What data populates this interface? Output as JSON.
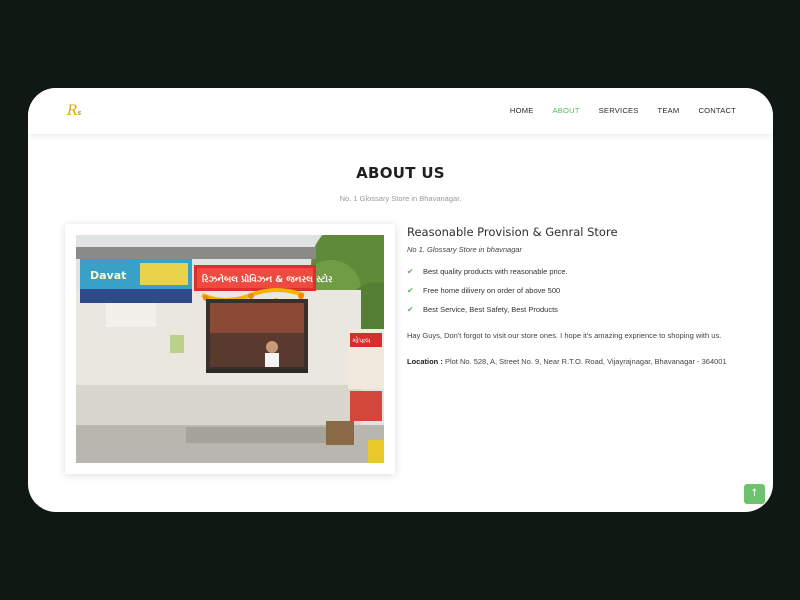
{
  "logo": {
    "text": "R",
    "sub": "s"
  },
  "nav": {
    "items": [
      "HOME",
      "ABOUT",
      "SERVICES",
      "TEAM",
      "CONTACT"
    ],
    "active": "ABOUT"
  },
  "section": {
    "title": "ABOUT US",
    "subtitle": "No. 1 Glossary Store in Bhavanagar."
  },
  "photo": {
    "sign_left": "Davat",
    "sign_right": "રિઝનેબલ પ્રોવિઝન & જનરલ સ્ટોર",
    "banner_right": "ગોપાલ"
  },
  "about": {
    "heading": "Reasonable Provision & Genral Store",
    "tagline": "No 1. Glossary Store in bhavnagar",
    "features": [
      "Best quality products with reasonable price.",
      "Free home dilivery on order of above 500",
      "Best Service, Best Safety, Best Products"
    ],
    "intro": "Hay Guys, Don't forgot to visit our store ones. I hope it's amazing exprience to shoping with us.",
    "location_label": "Location :",
    "location_text": "Plot No. 528, A, Street No. 9, Near R.T.O. Road, Vijayrajnagar, Bhavanagar - 364001"
  },
  "scroll_top": {
    "icon": "arrow-up-icon",
    "glyph": "↑"
  },
  "colors": {
    "accent": "#5cb85c",
    "background": "#0f1812"
  }
}
